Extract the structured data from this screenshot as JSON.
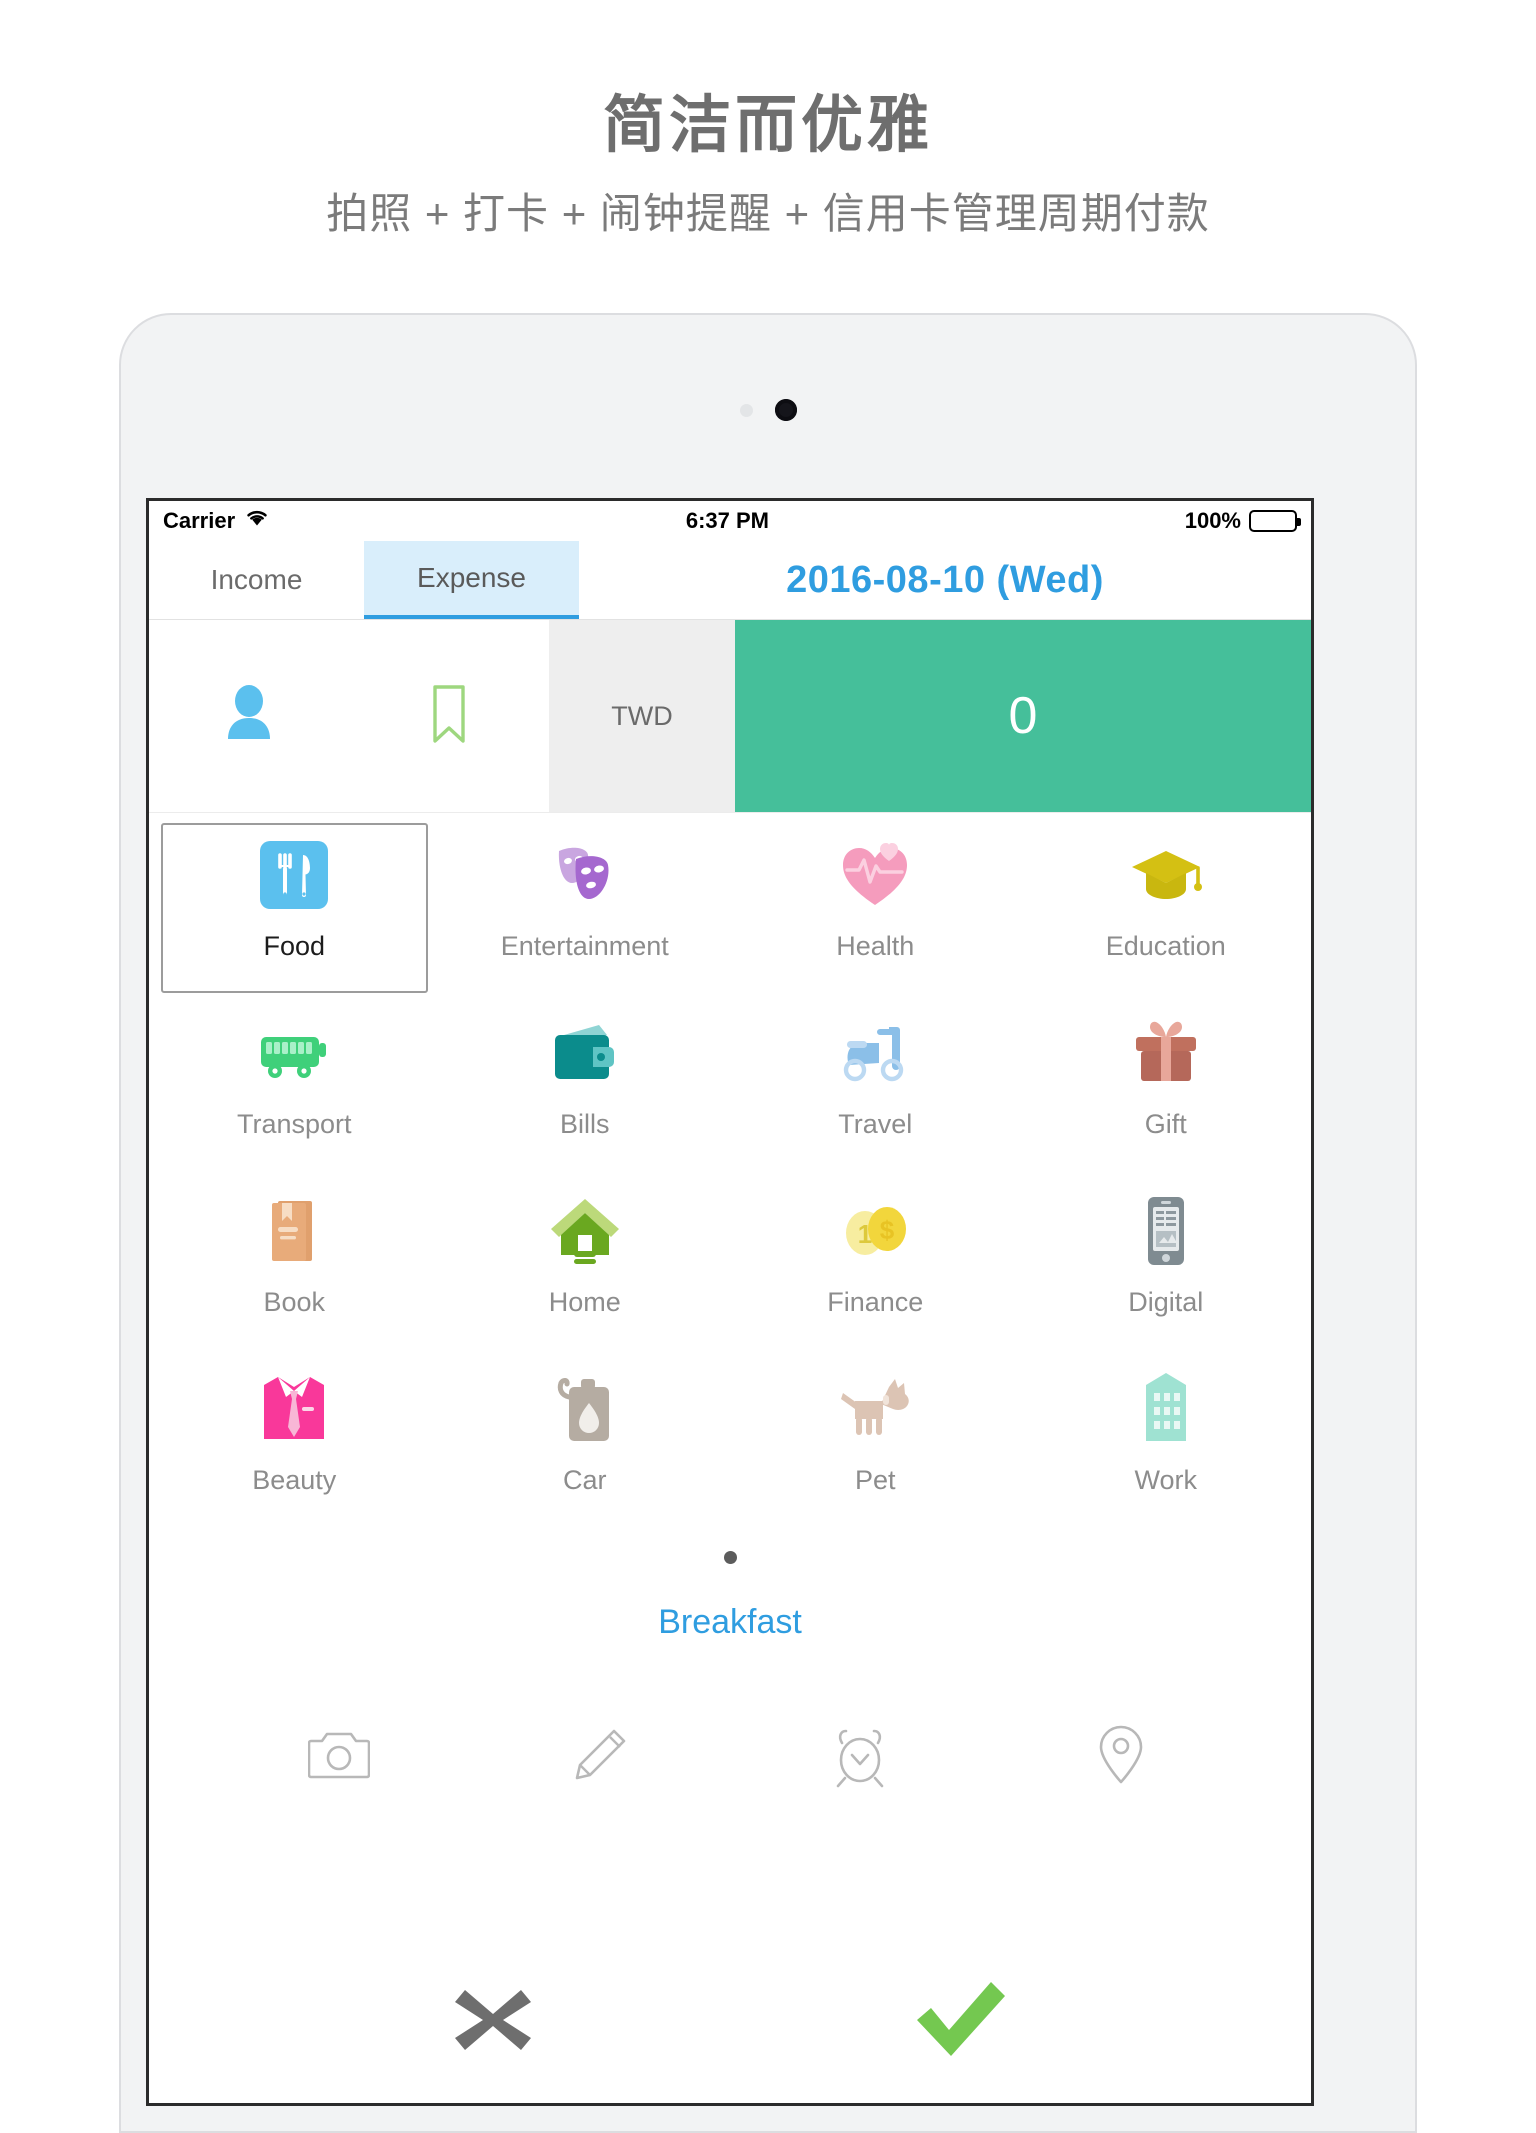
{
  "promo": {
    "title": "简洁而优雅",
    "subtitle": "拍照 + 打卡 + 闹钟提醒 + 信用卡管理周期付款"
  },
  "statusbar": {
    "carrier": "Carrier",
    "wifi_icon": "wifi-icon",
    "time": "6:37 PM",
    "battery_percent": "100%",
    "battery_icon": "battery-full-icon"
  },
  "topbar": {
    "tabs": [
      {
        "label": "Income",
        "selected": false
      },
      {
        "label": "Expense",
        "selected": true
      }
    ],
    "date": "2016-08-10 (Wed)"
  },
  "amount_row": {
    "person_icon": "person-icon",
    "bookmark_icon": "bookmark-icon",
    "currency": "TWD",
    "amount": "0"
  },
  "categories": [
    {
      "label": "Food",
      "icon": "food-icon",
      "selected": true
    },
    {
      "label": "Entertainment",
      "icon": "masks-icon",
      "selected": false
    },
    {
      "label": "Health",
      "icon": "heart-pulse-icon",
      "selected": false
    },
    {
      "label": "Education",
      "icon": "graduation-cap-icon",
      "selected": false
    },
    {
      "label": "Transport",
      "icon": "bus-icon",
      "selected": false
    },
    {
      "label": "Bills",
      "icon": "wallet-icon",
      "selected": false
    },
    {
      "label": "Travel",
      "icon": "scooter-icon",
      "selected": false
    },
    {
      "label": "Gift",
      "icon": "gift-icon",
      "selected": false
    },
    {
      "label": "Book",
      "icon": "book-icon",
      "selected": false
    },
    {
      "label": "Home",
      "icon": "house-icon",
      "selected": false
    },
    {
      "label": "Finance",
      "icon": "coins-icon",
      "selected": false
    },
    {
      "label": "Digital",
      "icon": "smartphone-icon",
      "selected": false
    },
    {
      "label": "Beauty",
      "icon": "shirt-tie-icon",
      "selected": false
    },
    {
      "label": "Car",
      "icon": "fuel-can-icon",
      "selected": false
    },
    {
      "label": "Pet",
      "icon": "dog-icon",
      "selected": false
    },
    {
      "label": "Work",
      "icon": "building-icon",
      "selected": false
    }
  ],
  "pager": {
    "pages": 1,
    "current": 1
  },
  "note": "Breakfast",
  "tools": [
    {
      "icon": "camera-icon"
    },
    {
      "icon": "pencil-icon"
    },
    {
      "icon": "alarm-clock-icon"
    },
    {
      "icon": "location-pin-icon"
    }
  ],
  "actions": {
    "cancel_icon": "close-x-icon",
    "confirm_icon": "check-icon"
  },
  "colors": {
    "accent_blue": "#2f9de0",
    "amount_green": "#45bf9a",
    "confirm_green": "#74c850",
    "cancel_gray": "#6e6e6e",
    "tab_selected_bg": "#d9eefb"
  }
}
